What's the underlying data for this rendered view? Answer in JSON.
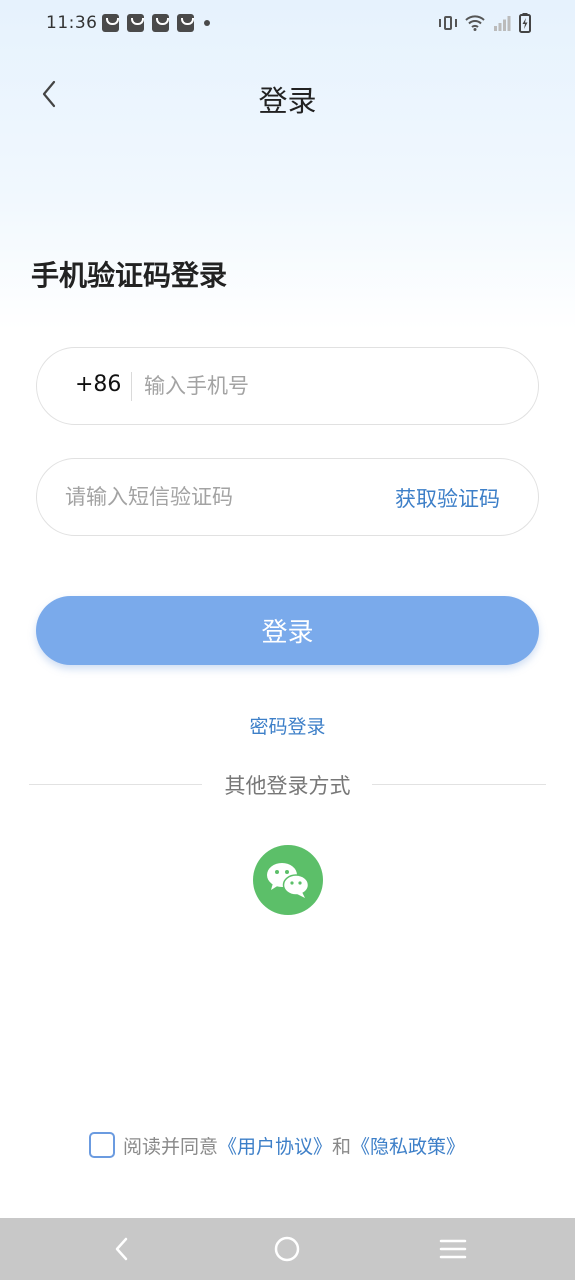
{
  "status_bar": {
    "time": "11:36",
    "notification_icons": [
      "shopping-bag-icon",
      "shopping-bag-icon",
      "shopping-bag-icon",
      "shopping-bag-icon",
      "dot-icon"
    ],
    "system_icons": [
      "vibrate-icon",
      "wifi-icon",
      "signal-icon",
      "battery-charging-icon"
    ]
  },
  "header": {
    "title": "登录"
  },
  "form": {
    "section_title": "手机验证码登录",
    "country_code": "+86",
    "phone_placeholder": "输入手机号",
    "phone_value": "",
    "code_placeholder": "请输入短信验证码",
    "code_value": "",
    "get_code_label": "获取验证码",
    "login_label": "登录",
    "password_login_label": "密码登录"
  },
  "other_login": {
    "label": "其他登录方式",
    "methods": [
      "wechat-icon"
    ]
  },
  "agreement": {
    "checked": false,
    "prefix": "阅读并同意",
    "user_agreement": "《用户协议》",
    "conjunction": "和",
    "privacy_policy": "《隐私政策》"
  },
  "colors": {
    "accent": "#3d7fc8",
    "login_button": "#7aaaeb",
    "wechat": "#5cbf69",
    "nav_bar": "#c8c8c8"
  }
}
